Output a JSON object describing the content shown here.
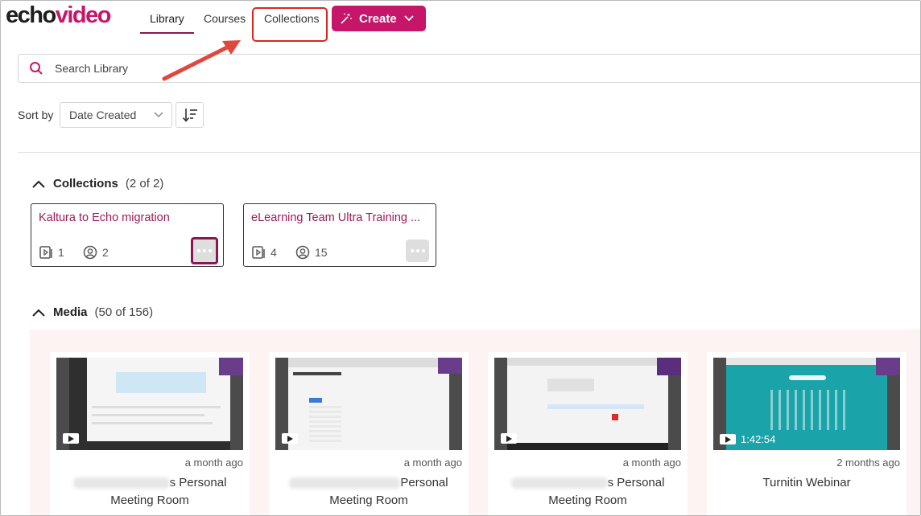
{
  "logo": {
    "part1": "echo",
    "part2": "video"
  },
  "nav": {
    "library": "Library",
    "courses": "Courses",
    "collections": "Collections",
    "create": "Create"
  },
  "search": {
    "placeholder": "Search Library"
  },
  "sort": {
    "label": "Sort by",
    "selected": "Date Created"
  },
  "collections_section": {
    "title": "Collections",
    "count": "(2 of 2)",
    "items": [
      {
        "title": "Kaltura to Echo migration",
        "media_count": "1",
        "member_count": "2"
      },
      {
        "title": "eLearning Team Ultra Training ...",
        "media_count": "4",
        "member_count": "15"
      }
    ]
  },
  "media_section": {
    "title": "Media",
    "count": "(50 of 156)",
    "items": [
      {
        "duration": "",
        "date": "a month ago",
        "title_suffix": "s Personal",
        "title_line2": "Meeting Room"
      },
      {
        "duration": "",
        "date": "a month ago",
        "title_suffix": "Personal",
        "title_line2": "Meeting Room"
      },
      {
        "duration": "",
        "date": "a month ago",
        "title_suffix": "s Personal",
        "title_line2": "Meeting Room"
      },
      {
        "duration": "1:42:54",
        "date": "2 months ago",
        "title_suffix": "Turnitin Webinar",
        "title_line2": ""
      }
    ]
  },
  "colors": {
    "brand": "#c5166a",
    "tab_underline": "#8a1755",
    "annotation": "#d9281e",
    "collection_title": "#9b1b59"
  }
}
